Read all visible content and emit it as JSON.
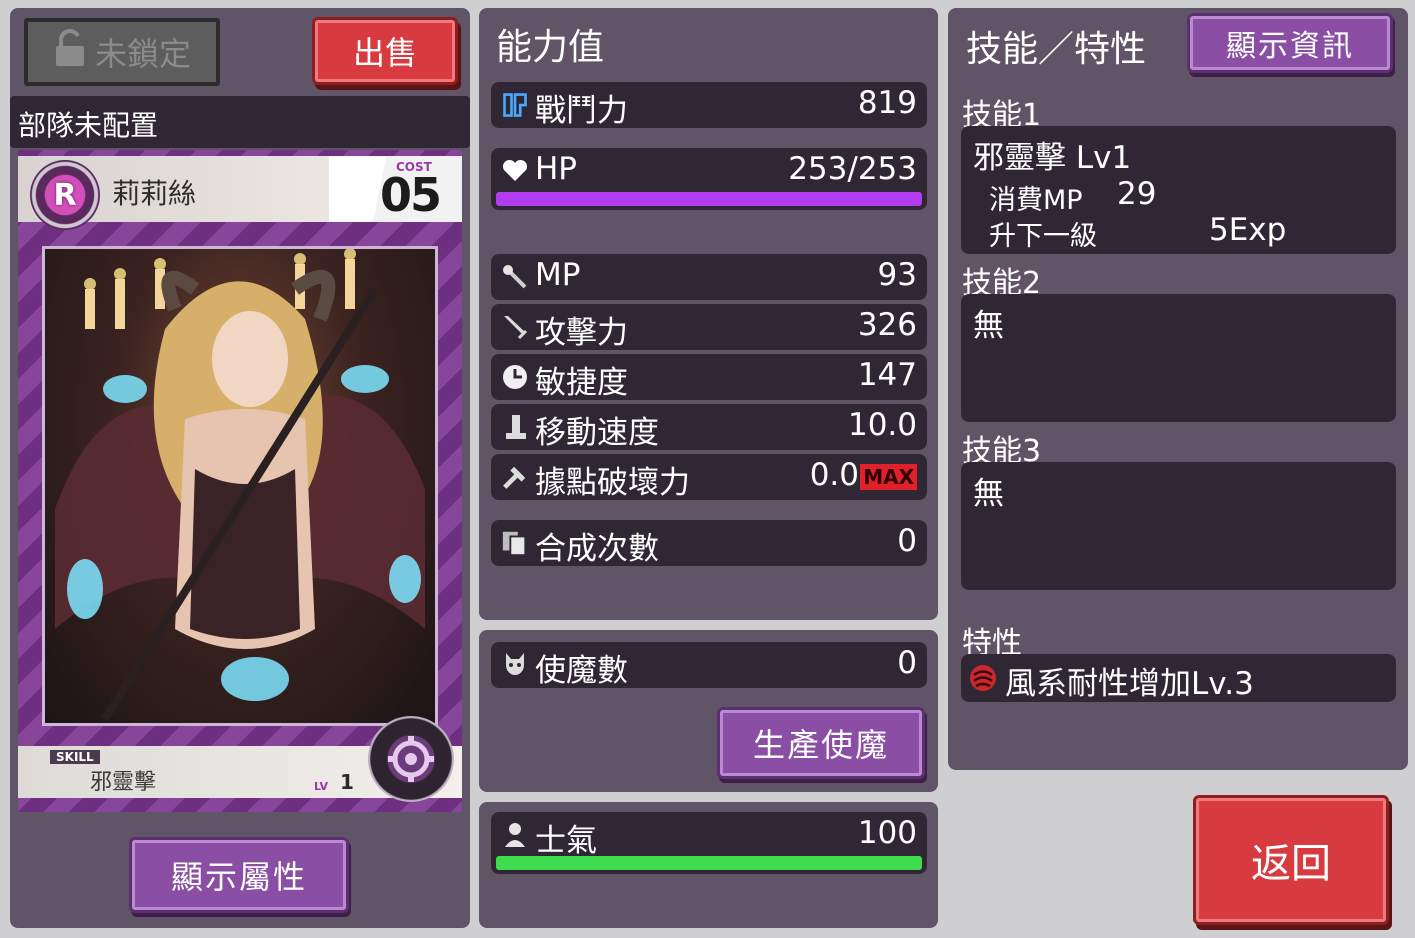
{
  "left": {
    "lock_label": "未鎖定",
    "sell_label": "出售",
    "deploy_status": "部隊未配置",
    "card": {
      "rarity": "R",
      "name": "莉莉絲",
      "cost_label": "COST",
      "cost_value": "05",
      "skill_tag": "SKILL",
      "skill_name": "邪靈擊",
      "lv_label": "LV",
      "lv_value": "1"
    },
    "show_attr_label": "顯示屬性"
  },
  "stats": {
    "title": "能力值",
    "combat": {
      "label": "戰鬥力",
      "value": "819"
    },
    "hp": {
      "label": "HP",
      "value": "253/253",
      "fill": 1.0
    },
    "mp": {
      "label": "MP",
      "value": "93"
    },
    "attack": {
      "label": "攻擊力",
      "value": "326"
    },
    "agility": {
      "label": "敏捷度",
      "value": "147"
    },
    "move": {
      "label": "移動速度",
      "value": "10.0"
    },
    "destroy": {
      "label": "據點破壞力",
      "value": "0.0",
      "badge": "MAX"
    },
    "synth": {
      "label": "合成次數",
      "value": "0"
    },
    "familiar": {
      "label": "使魔數",
      "value": "0"
    },
    "produce_label": "生產使魔",
    "morale": {
      "label": "士氣",
      "value": "100",
      "fill": 1.0
    }
  },
  "skills": {
    "title": "技能／特性",
    "show_info_label": "顯示資訊",
    "skill1": {
      "heading": "技能1",
      "name": "邪靈擊 Lv1",
      "mp_label": "消費MP",
      "mp_value": "29",
      "next_label": "升下一級",
      "next_value": "5Exp"
    },
    "skill2": {
      "heading": "技能2",
      "value": "無"
    },
    "skill3": {
      "heading": "技能3",
      "value": "無"
    },
    "trait": {
      "heading": "特性",
      "value": "風系耐性增加Lv.3"
    }
  },
  "return_label": "返回",
  "colors": {
    "panel": "#5f5566",
    "row": "#2f2834",
    "hp_bar": "#b23cf0",
    "morale_bar": "#3fdc4f",
    "button_purple": "#8a4fa4",
    "button_red": "#d73a3f"
  }
}
